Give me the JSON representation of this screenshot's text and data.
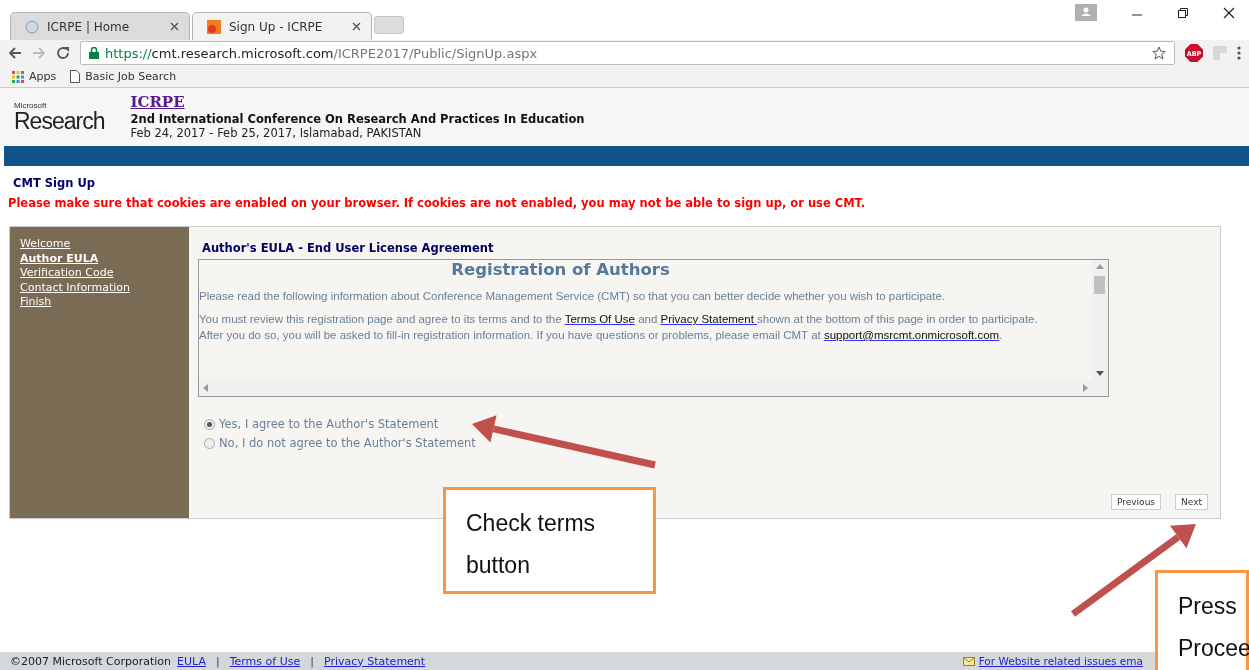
{
  "browser": {
    "tabs": [
      {
        "label": "ICRPE | Home",
        "selected": false
      },
      {
        "label": "Sign Up - ICRPE",
        "selected": true
      }
    ],
    "url": {
      "scheme": "https://",
      "host": "cmt.research.microsoft.com",
      "path": "/ICRPE2017/Public/SignUp.aspx"
    },
    "extension_label": "ABP",
    "bookmarks": [
      "Apps",
      "Basic Job Search"
    ]
  },
  "header": {
    "logo_small": "Microsoft",
    "logo_large": "Research",
    "title": "ICRPE",
    "subtitle": "2nd International Conference On Research And Practices In Education",
    "dates": "Feb 24, 2017 - Feb 25, 2017, Islamabad, PAKISTAN"
  },
  "page_title": "CMT Sign Up",
  "warning": "Please make sure that cookies are enabled on your browser. If cookies are not enabled, you may not be able to sign up, or use CMT.",
  "sidebar": {
    "items": [
      {
        "label": "Welcome",
        "selected": false
      },
      {
        "label": "Author EULA",
        "selected": true
      },
      {
        "label": "Verification Code",
        "selected": false
      },
      {
        "label": "Contact Information",
        "selected": false
      },
      {
        "label": "Finish",
        "selected": false
      }
    ]
  },
  "section_title": "Author's EULA - End User License Agreement",
  "eula": {
    "heading": "Registration of Authors",
    "paragraphs": [
      {
        "lines": [
          [
            {
              "text": "Please read the following information about Conference Management Service (CMT) so that you can better decide whether you wish to participate.",
              "link": false
            }
          ]
        ]
      },
      {
        "lines": [
          [
            {
              "text": "You must review this registration page and agree to its terms and to the ",
              "link": false
            },
            {
              "text": "Terms Of Use",
              "link": true
            },
            {
              "text": " and ",
              "link": false
            },
            {
              "text": "Privacy Statement ",
              "link": true
            },
            {
              "text": "shown at the bottom of this page in order to participate.",
              "link": false
            }
          ],
          [
            {
              "text": "After you do so, you will be asked to fill-in registration information. If you have questions or problems, please email CMT at ",
              "link": false
            },
            {
              "text": "support@msrcmt.onmicrosoft.com",
              "link": true
            },
            {
              "text": ".",
              "link": false
            }
          ]
        ]
      }
    ]
  },
  "radios": [
    {
      "label": "Yes, I agree to the Author's Statement",
      "selected": true
    },
    {
      "label": "No, I do not agree to the Author's Statement",
      "selected": false
    }
  ],
  "buttons": [
    "Previous",
    "Next"
  ],
  "footer": {
    "items": [
      {
        "text": "©2007 Microsoft Corporation",
        "kind": "text"
      },
      {
        "text": "EULA",
        "kind": "link"
      },
      {
        "text": "|",
        "kind": "separator"
      },
      {
        "text": "Terms of Use",
        "kind": "link"
      },
      {
        "text": "|",
        "kind": "separator"
      },
      {
        "text": "Privacy Statement",
        "kind": "link"
      }
    ],
    "contact": "For Website related issues ema"
  },
  "annotations": [
    {
      "lines": [
        "Check terms",
        "button"
      ]
    },
    {
      "lines": [
        "Press",
        "Procee"
      ]
    }
  ]
}
